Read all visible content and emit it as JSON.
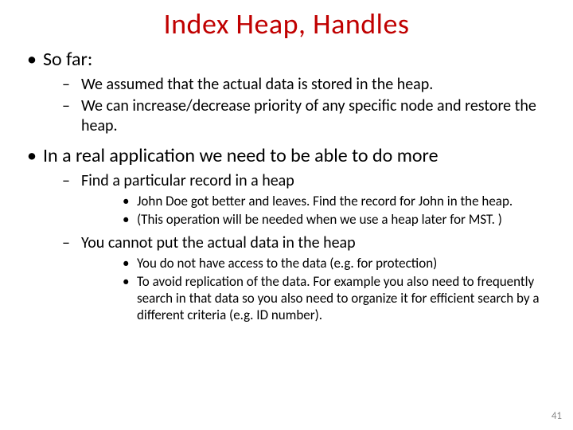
{
  "title": "Index Heap, Handles",
  "bullets": {
    "b1": "So far:",
    "b1_1": "We assumed that the actual data is stored in the heap.",
    "b1_2": "We can increase/decrease priority of any specific node and restore the heap.",
    "b2": "In a real application we need to be able to do more",
    "b2_1": "Find a particular record in a heap",
    "b2_1_1": "John Doe got better and leaves. Find the record for John in the heap.",
    "b2_1_2": "(This operation will be needed when we use a heap later for MST. )",
    "b2_2": "You cannot put the actual data in the heap",
    "b2_2_1": "You do not have access to the data (e.g. for protection)",
    "b2_2_2": "To avoid replication of the data. For example you also need to frequently search in that data so you also need to organize it for efficient search by a different criteria (e.g. ID number)."
  },
  "page_number": "41"
}
